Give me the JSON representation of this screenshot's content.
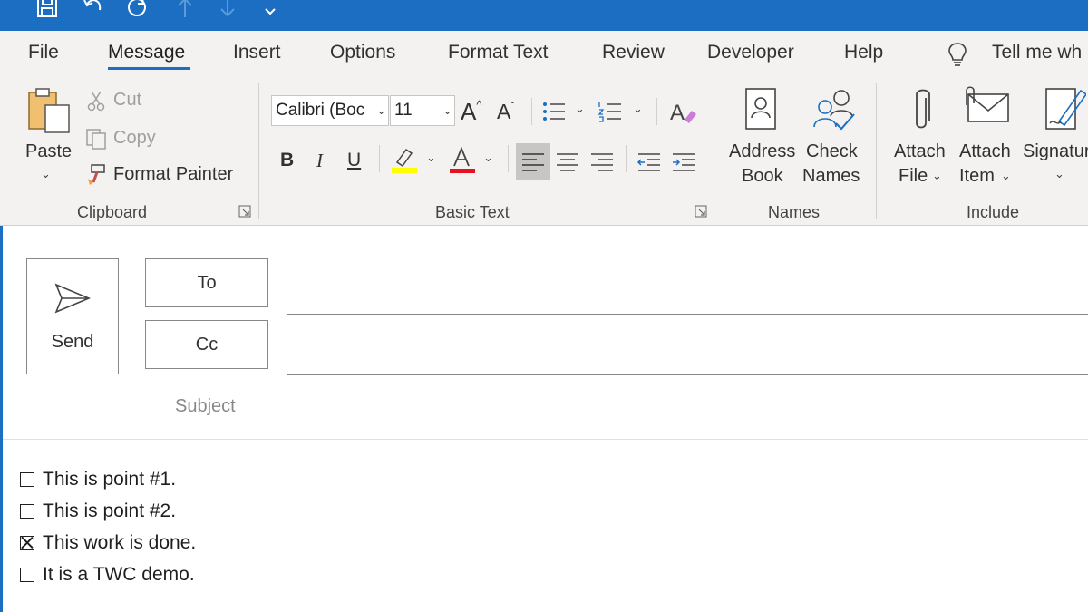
{
  "quick_access": {
    "icons": [
      "save-icon",
      "undo-icon",
      "redo-icon",
      "up-arrow-icon",
      "down-arrow-icon",
      "customize-chevron-icon"
    ]
  },
  "tabs": [
    {
      "label": "File",
      "active": false
    },
    {
      "label": "Message",
      "active": true
    },
    {
      "label": "Insert",
      "active": false
    },
    {
      "label": "Options",
      "active": false
    },
    {
      "label": "Format Text",
      "active": false
    },
    {
      "label": "Review",
      "active": false
    },
    {
      "label": "Developer",
      "active": false
    },
    {
      "label": "Help",
      "active": false
    },
    {
      "label": "Tell me wh",
      "active": false
    }
  ],
  "ribbon": {
    "clipboard": {
      "paste": "Paste",
      "cut": "Cut",
      "copy": "Copy",
      "format_painter": "Format Painter",
      "label": "Clipboard"
    },
    "basic_text": {
      "font_name": "Calibri (Boc",
      "font_size": "11",
      "bold": "B",
      "italic": "I",
      "underline": "U",
      "font_color_letter": "A",
      "label": "Basic Text",
      "highlight_color": "#ffff00",
      "font_color": "#e81123"
    },
    "names": {
      "address_book_1": "Address",
      "address_book_2": "Book",
      "check_names_1": "Check",
      "check_names_2": "Names",
      "label": "Names"
    },
    "include": {
      "attach_file_1": "Attach",
      "attach_file_2": "File",
      "attach_item_1": "Attach",
      "attach_item_2": "Item",
      "signature": "Signatur",
      "label": "Include"
    }
  },
  "compose": {
    "send": "Send",
    "to": "To",
    "cc": "Cc",
    "subject_placeholder": "Subject"
  },
  "body": {
    "lines": [
      {
        "text": "This is point #1.",
        "checked": false
      },
      {
        "text": "This is point #2.",
        "checked": false
      },
      {
        "text": "This work is done.",
        "checked": true
      },
      {
        "text": "It is a TWC demo.",
        "checked": false
      }
    ]
  },
  "colors": {
    "accent": "#1b6ec2",
    "ribbon_bg": "#f3f2f1"
  }
}
